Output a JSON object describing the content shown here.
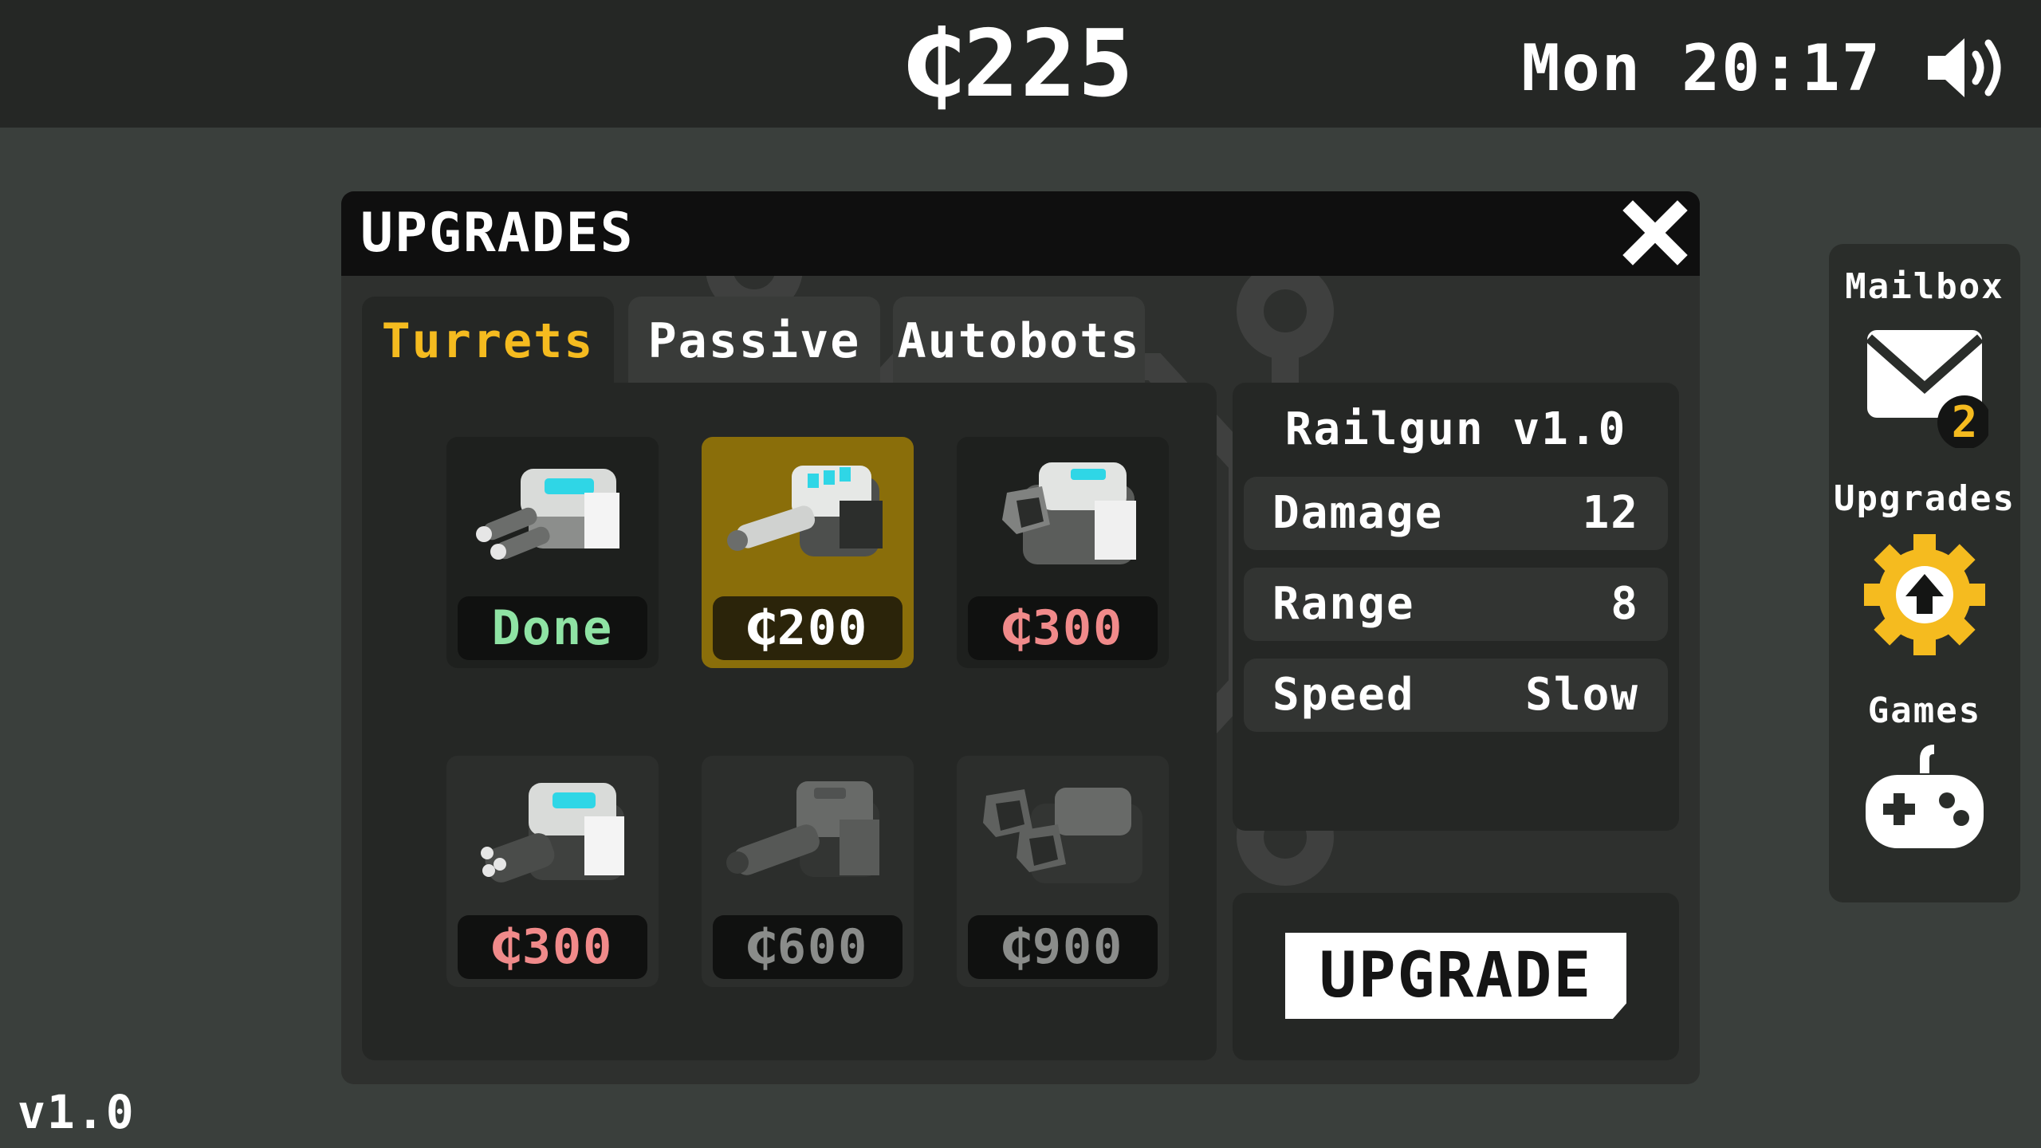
{
  "top_bar": {
    "currency": "₵225",
    "clock": "Mon 20:17",
    "sound_icon": "speaker-icon"
  },
  "panel": {
    "title": "UPGRADES",
    "close_icon": "close-icon",
    "tabs": [
      {
        "label": "Turrets",
        "active": true
      },
      {
        "label": "Passive",
        "active": false
      },
      {
        "label": "Autobots",
        "active": false
      }
    ],
    "turrets": [
      {
        "price": "Done",
        "state": "done",
        "price_color": "#8fe3a4"
      },
      {
        "price": "₵200",
        "state": "selected",
        "price_color": "#ffffff"
      },
      {
        "price": "₵300",
        "state": "unaffordable",
        "price_color": "#f08a8a"
      },
      {
        "price": "₵300",
        "state": "unaffordable",
        "price_color": "#f08a8a"
      },
      {
        "price": "₵600",
        "state": "locked",
        "price_color": "#8a8c8a"
      },
      {
        "price": "₵900",
        "state": "locked",
        "price_color": "#8a8c8a"
      }
    ],
    "details": {
      "name": "Railgun v1.0",
      "stats": [
        {
          "label": "Damage",
          "value": "12"
        },
        {
          "label": "Range",
          "value": "8"
        },
        {
          "label": "Speed",
          "value": "Slow"
        }
      ],
      "upgrade_label": "UPGRADE"
    }
  },
  "sidebar": {
    "items": [
      {
        "label": "Mailbox",
        "icon": "mail-icon",
        "badge": "2"
      },
      {
        "label": "Upgrades",
        "icon": "upgrade-gear-icon"
      },
      {
        "label": "Games",
        "icon": "gamepad-icon"
      }
    ]
  },
  "version": "v1.0",
  "colors": {
    "accent": "#f5bb1f",
    "selected_card": "#8a6e0a",
    "done": "#8fe3a4",
    "unaffordable": "#f08a8a",
    "locked": "#8a8c8a"
  }
}
